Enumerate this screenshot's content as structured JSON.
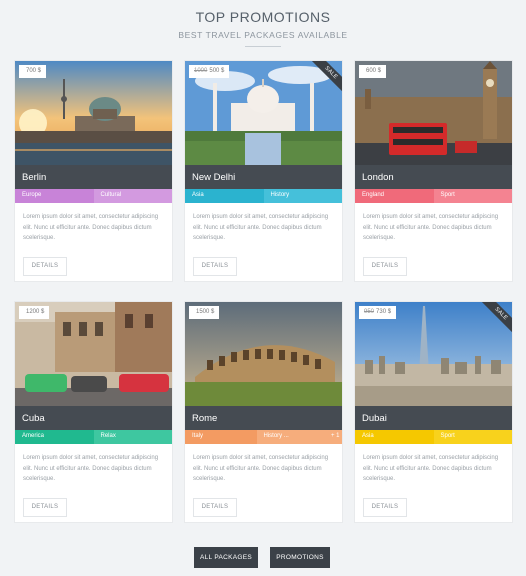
{
  "header": {
    "title": "TOP PROMOTIONS",
    "subtitle": "BEST TRAVEL PACKAGES AVAILABLE"
  },
  "cards": [
    {
      "city": "Berlin",
      "price": "700 $",
      "old_price": "",
      "sale": "",
      "tags": [
        "Europe",
        "Cultural",
        ""
      ],
      "tag_colors": [
        "#c883d8",
        "#d39ae0"
      ],
      "description": "Lorem ipsum dolor sit amet, consectetur adipiscing elit. Nunc ut efficitur ante. Donec dapibus dictum scelerisque.",
      "button": "DETAILS"
    },
    {
      "city": "New Delhi",
      "price": "500 $",
      "old_price": "1000",
      "sale": "SALE",
      "tags": [
        "Asia",
        "History",
        ""
      ],
      "tag_colors": [
        "#2bb3cf",
        "#45c0da"
      ],
      "description": "Lorem ipsum dolor sit amet, consectetur adipiscing elit. Nunc ut efficitur ante. Donec dapibus dictum scelerisque.",
      "button": "DETAILS"
    },
    {
      "city": "London",
      "price": "600 $",
      "old_price": "",
      "sale": "",
      "tags": [
        "England",
        "Sport",
        ""
      ],
      "tag_colors": [
        "#f06a7a",
        "#f48391"
      ],
      "description": "Lorem ipsum dolor sit amet, consectetur adipiscing elit. Nunc ut efficitur ante. Donec dapibus dictum scelerisque.",
      "button": "DETAILS"
    },
    {
      "city": "Cuba",
      "price": "1200 $",
      "old_price": "",
      "sale": "",
      "tags": [
        "America",
        "Relax",
        ""
      ],
      "tag_colors": [
        "#20b98f",
        "#3ec7a0"
      ],
      "description": "Lorem ipsum dolor sit amet, consectetur adipiscing elit. Nunc ut efficitur ante. Donec dapibus dictum scelerisque.",
      "button": "DETAILS"
    },
    {
      "city": "Rome",
      "price": "1500 $",
      "old_price": "",
      "sale": "",
      "tags": [
        "Italy",
        "History ...",
        "+ 1"
      ],
      "tag_colors": [
        "#f39b62",
        "#f6ad7c"
      ],
      "description": "Lorem ipsum dolor sit amet, consectetur adipiscing elit. Nunc ut efficitur ante. Donec dapibus dictum scelerisque.",
      "button": "DETAILS"
    },
    {
      "city": "Dubai",
      "price": "730 $",
      "old_price": "950",
      "sale": "SALE",
      "tags": [
        "Asia",
        "Sport",
        ""
      ],
      "tag_colors": [
        "#f5c800",
        "#f8d21c"
      ],
      "description": "Lorem ipsum dolor sit amet, consectetur adipiscing elit. Nunc ut efficitur ante. Donec dapibus dictum scelerisque.",
      "button": "DETAILS"
    }
  ],
  "footer": {
    "all_packages": "ALL PACKAGES",
    "promotions": "PROMOTIONS"
  }
}
